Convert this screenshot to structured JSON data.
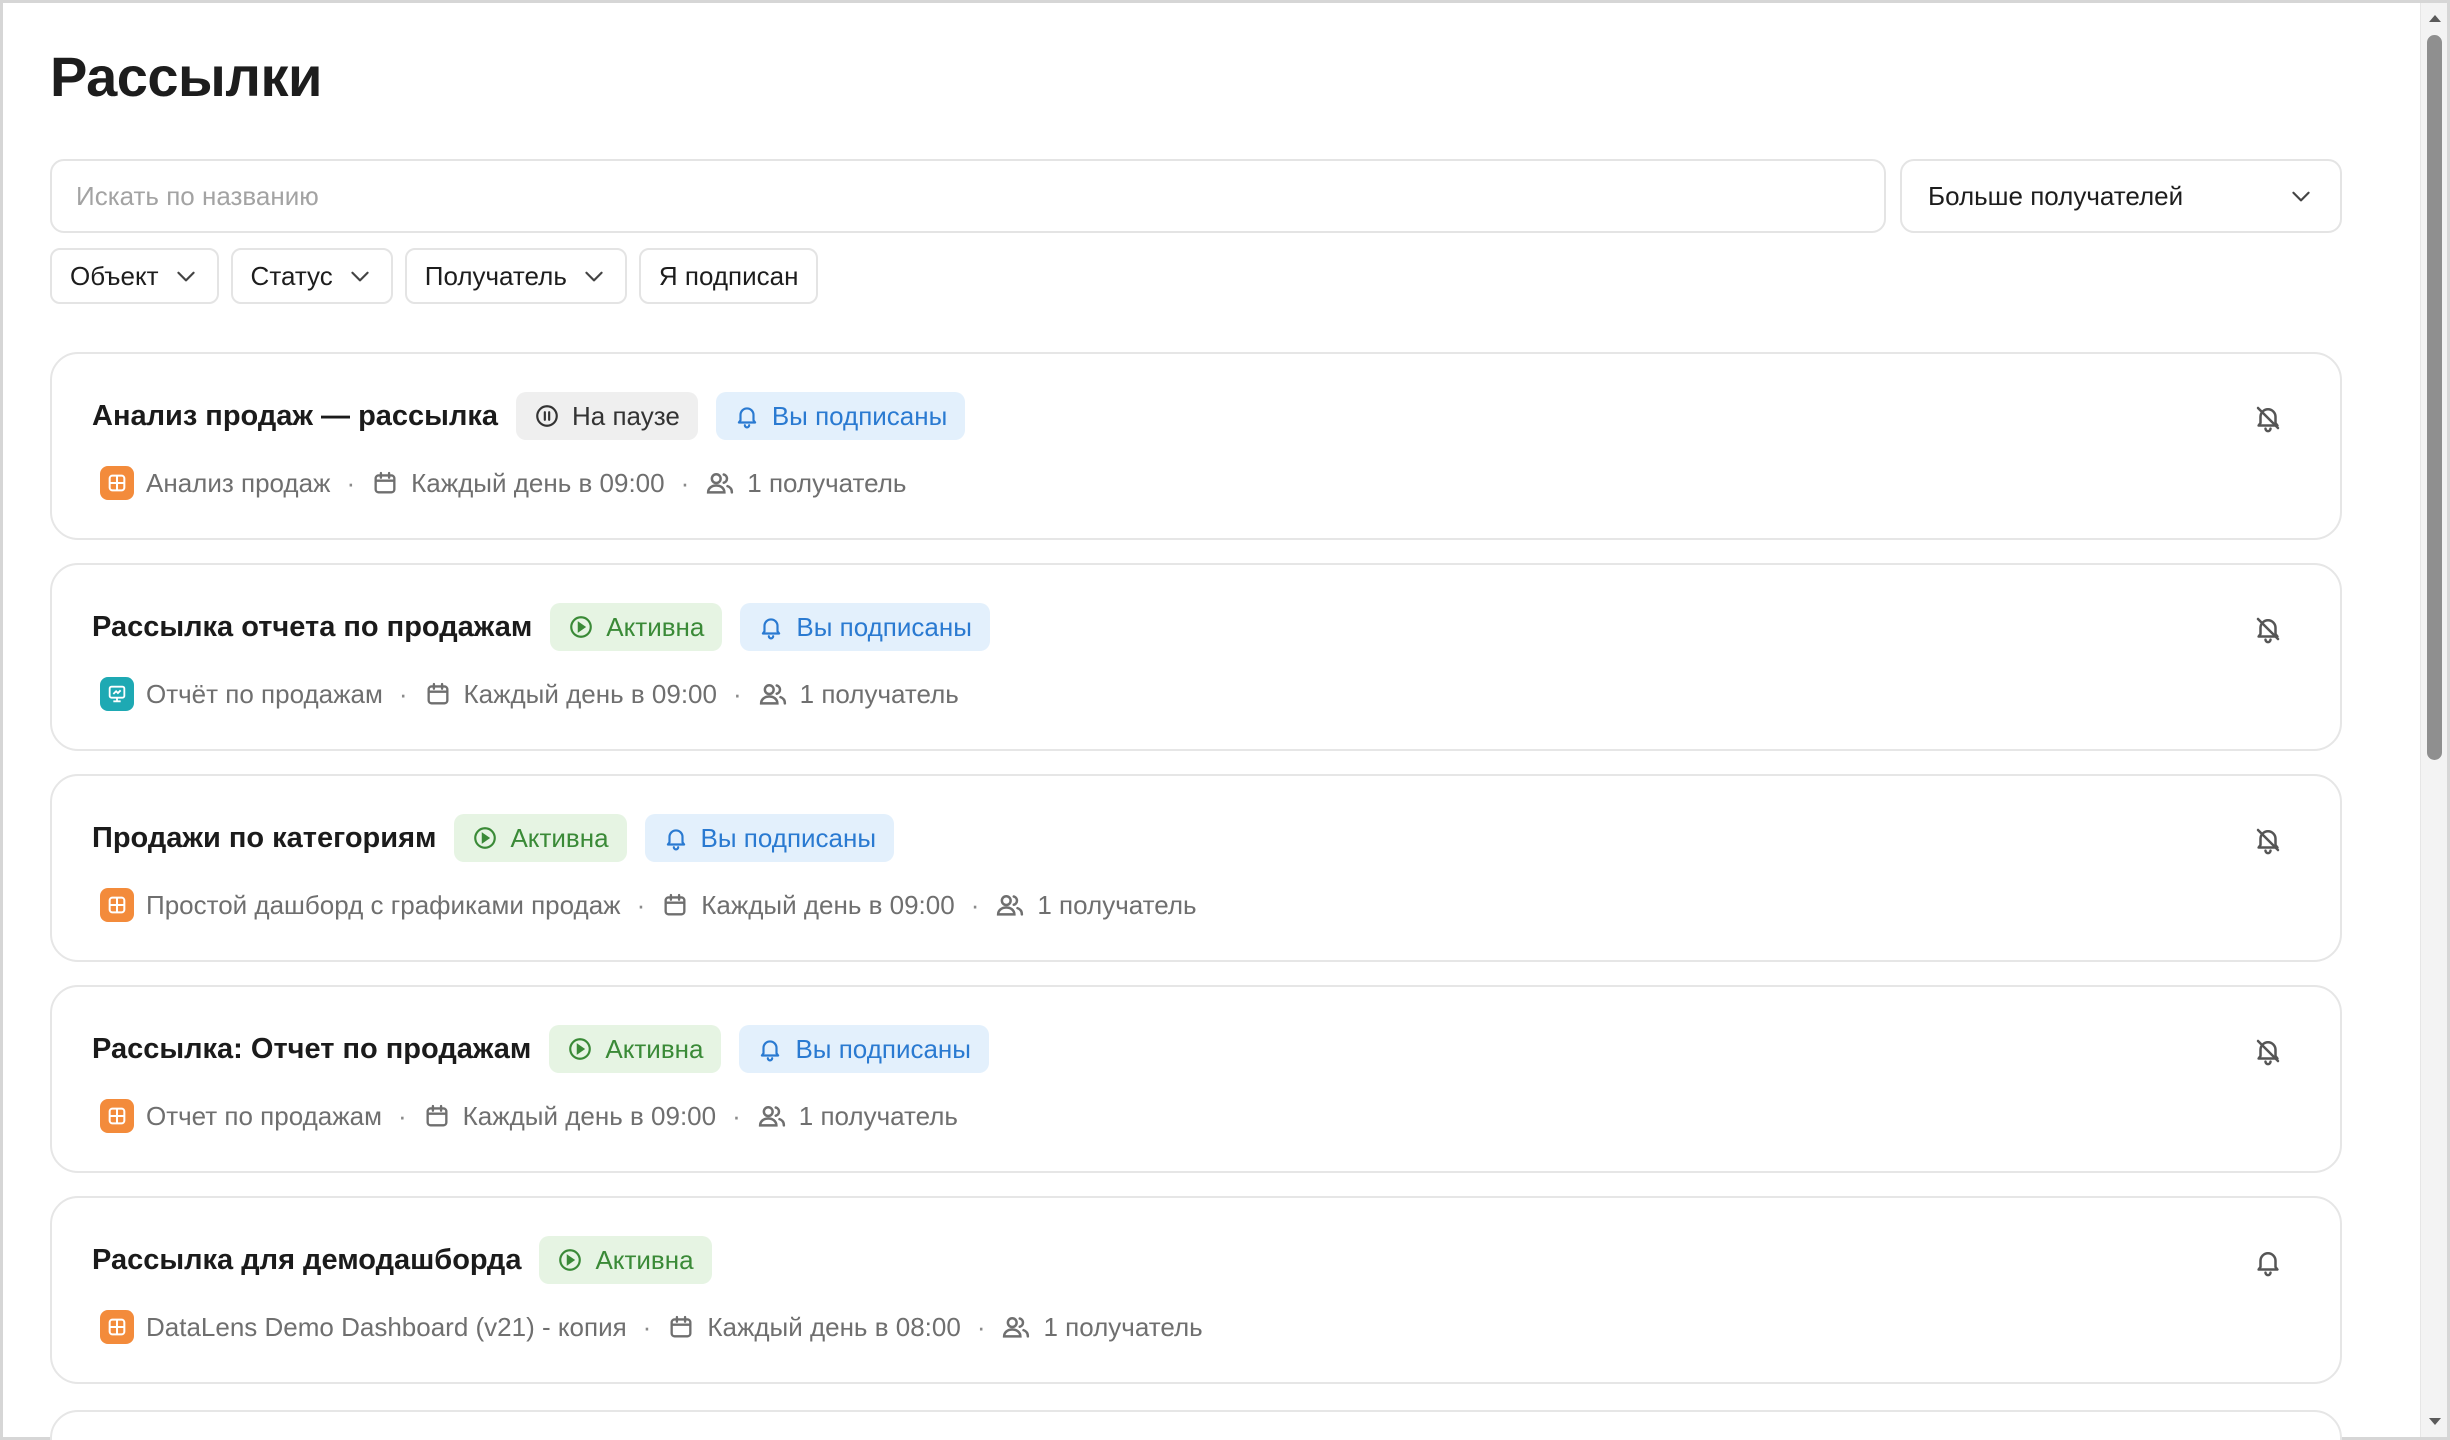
{
  "page": {
    "title": "Рассылки"
  },
  "search": {
    "placeholder": "Искать по названию"
  },
  "sort_select": {
    "value": "Больше получателей"
  },
  "filters": [
    {
      "label": "Объект"
    },
    {
      "label": "Статус"
    },
    {
      "label": "Получатель"
    },
    {
      "label": "Я подписан"
    }
  ],
  "colors": {
    "active_text": "#3a8a37",
    "active_bg": "#e6f4e3",
    "subscribed_text": "#2a7ad1",
    "subscribed_bg": "#e3f0fc",
    "paused_bg": "#efefef",
    "object_orange": "#f38b3b",
    "object_teal": "#1ea9b3"
  },
  "subscriptions": [
    {
      "title": "Анализ продаж — рассылка",
      "status": {
        "label": "На паузе",
        "kind": "paused",
        "icon": "pause-circle-icon"
      },
      "subscribed_label": "Вы подписаны",
      "object": {
        "name": "Анализ продаж",
        "icon": "dashboard-icon"
      },
      "schedule": "Каждый день в 09:00",
      "recipients": "1 получатель",
      "bell_icon": "bell-slash-icon"
    },
    {
      "title": "Рассылка отчета по продажам",
      "status": {
        "label": "Активна",
        "kind": "active",
        "icon": "play-circle-icon"
      },
      "subscribed_label": "Вы подписаны",
      "object": {
        "name": "Отчёт по продажам",
        "icon": "report-icon"
      },
      "schedule": "Каждый день в 09:00",
      "recipients": "1 получатель",
      "bell_icon": "bell-slash-icon"
    },
    {
      "title": "Продажи по категориям",
      "status": {
        "label": "Активна",
        "kind": "active",
        "icon": "play-circle-icon"
      },
      "subscribed_label": "Вы подписаны",
      "object": {
        "name": "Простой дашборд с графиками продаж",
        "icon": "dashboard-icon"
      },
      "schedule": "Каждый день в 09:00",
      "recipients": "1 получатель",
      "bell_icon": "bell-slash-icon"
    },
    {
      "title": "Рассылка: Отчет по продажам",
      "status": {
        "label": "Активна",
        "kind": "active",
        "icon": "play-circle-icon"
      },
      "subscribed_label": "Вы подписаны",
      "object": {
        "name": "Отчет по продажам",
        "icon": "dashboard-icon"
      },
      "schedule": "Каждый день в 09:00",
      "recipients": "1 получатель",
      "bell_icon": "bell-slash-icon"
    },
    {
      "title": "Рассылка для демодашборда",
      "status": {
        "label": "Активна",
        "kind": "active",
        "icon": "play-circle-icon"
      },
      "object": {
        "name": "DataLens Demo Dashboard (v21) - копия",
        "icon": "dashboard-icon"
      },
      "schedule": "Каждый день в 08:00",
      "recipients": "1 получатель",
      "bell_icon": "bell-icon"
    }
  ]
}
